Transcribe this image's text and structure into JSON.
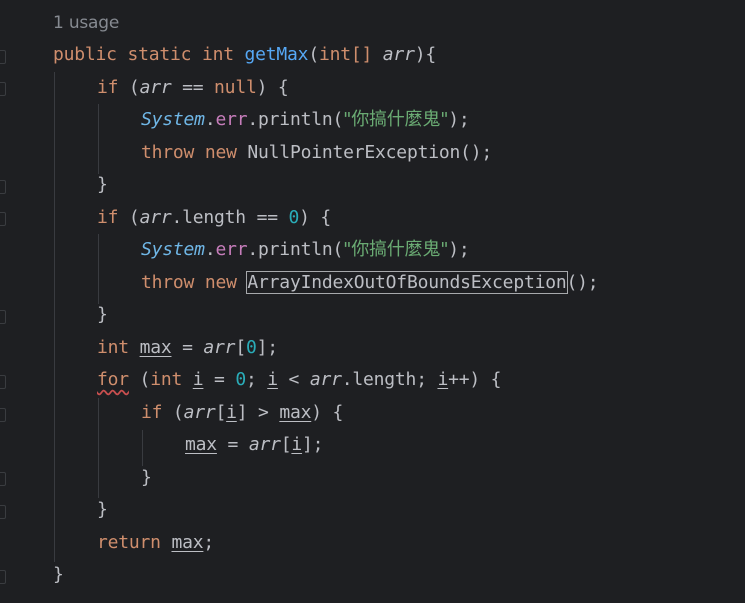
{
  "usage_hint": "1 usage",
  "code": {
    "sig_public": "public",
    "sig_static": "static",
    "sig_int": "int",
    "sig_name": "getMax",
    "sig_paren_open": "(",
    "sig_int2": "int[]",
    "sig_param": "arr",
    "sig_close": "){",
    "if1_kw": "if",
    "if1_open": "(",
    "if1_var": "arr",
    "if1_op": " == ",
    "if1_null": "null",
    "if1_close": ") {",
    "p1_sys": "System",
    "p1_dot": ".",
    "p1_err": "err",
    "p1_println": ".println(",
    "p1_str": "\"你搞什麼鬼\"",
    "p1_end": ");",
    "t1_throw": "throw",
    "t1_new": "new",
    "t1_cls": "NullPointerException",
    "t1_end": "();",
    "close1": "}",
    "if2_kw": "if",
    "if2_open": "(",
    "if2_var": "arr",
    "if2_len": ".length == ",
    "if2_zero": "0",
    "if2_close": ") {",
    "p2_sys": "System",
    "p2_dot": ".",
    "p2_err": "err",
    "p2_println": ".println(",
    "p2_str": "\"你搞什麼鬼\"",
    "p2_end": ");",
    "t2_throw": "throw",
    "t2_new": "new",
    "t2_cls": "ArrayIndexOutOfBoundsException",
    "t2_end": "();",
    "close2": "}",
    "m_int": "int",
    "m_var": "max",
    "m_eq": " = ",
    "m_arr": "arr",
    "m_b1": "[",
    "m_zero": "0",
    "m_b2": "];",
    "for_kw": "for",
    "for_open": " (",
    "for_int": "int",
    "for_i1": "i",
    "for_eq": " = ",
    "for_zero": "0",
    "for_semi": "; ",
    "for_i2": "i",
    "for_lt": " < ",
    "for_arr": "arr",
    "for_len": ".length; ",
    "for_i3": "i",
    "for_inc": "++",
    "for_close": ") {",
    "if3_kw": "if",
    "if3_open": " (",
    "if3_arr": "arr",
    "if3_b1": "[",
    "if3_i": "i",
    "if3_b2": "] > ",
    "if3_max": "max",
    "if3_close": ") {",
    "a_max": "max",
    "a_eq": " = ",
    "a_arr": "arr",
    "a_b1": "[",
    "a_i": "i",
    "a_b2": "];",
    "close3": "}",
    "close4": "}",
    "ret_kw": "return",
    "ret_var": "max",
    "ret_semi": ";",
    "close5": "}"
  }
}
